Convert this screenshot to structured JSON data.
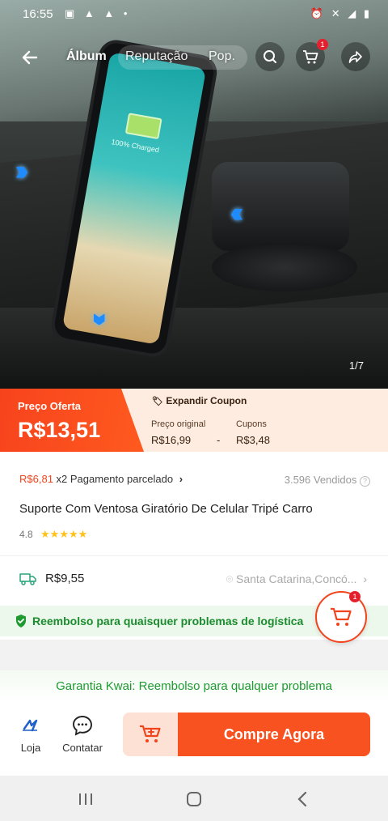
{
  "status_bar": {
    "time": "16:55",
    "left_icons": "▣ ▲ ▲ •",
    "right_icons": "⏰ ✕ ◢ ▮"
  },
  "top_nav": {
    "tabs": [
      "Álbum",
      "Reputação",
      "Pop."
    ],
    "cart_badge": "1"
  },
  "hero": {
    "image_counter": "1/7",
    "screen_text": "100% Charged"
  },
  "price": {
    "offer_label": "Preço Oferta",
    "offer_price": "R$13,51",
    "coupon_header": "Expandir Coupon",
    "original_label": "Preço original",
    "original_value": "R$16,99",
    "minus": "-",
    "coupons_label": "Cupons",
    "coupons_value": "R$3,48"
  },
  "installment": {
    "amount": "R$6,81",
    "text": "x2 Pagamento parcelado"
  },
  "sold": "3.596 Vendidos",
  "product_title": "Suporte Com Ventosa Giratório De Celular Tripé Carro",
  "rating": {
    "score": "4.8",
    "stars": "★★★★★"
  },
  "shipping": {
    "price": "R$9,55",
    "location": "Santa Catarina,Concó..."
  },
  "refund_text": "Reembolso para quaisquer problemas de logística",
  "floating_cart_badge": "1",
  "guarantee_text": "Garantia Kwai: Reembolso para qualquer problema",
  "bottom_bar": {
    "store_label": "Loja",
    "contact_label": "Contatar",
    "buy_label": "Compre Agora"
  },
  "colors": {
    "accent": "#f7521f",
    "green": "#1f9a31",
    "star": "#ffc21a"
  }
}
